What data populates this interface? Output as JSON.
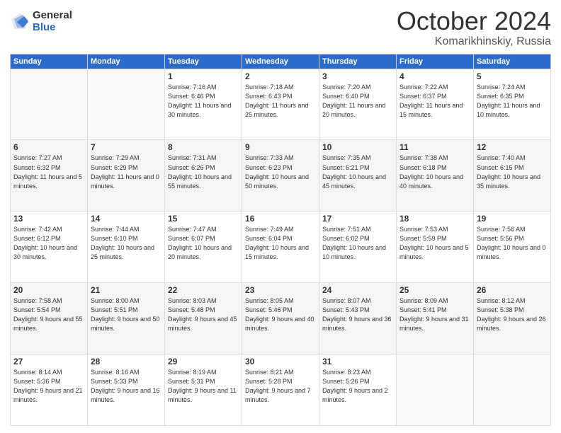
{
  "logo": {
    "general": "General",
    "blue": "Blue"
  },
  "title": {
    "month": "October 2024",
    "location": "Komarikhinskiy, Russia"
  },
  "weekdays": [
    "Sunday",
    "Monday",
    "Tuesday",
    "Wednesday",
    "Thursday",
    "Friday",
    "Saturday"
  ],
  "weeks": [
    [
      {
        "day": "",
        "info": ""
      },
      {
        "day": "",
        "info": ""
      },
      {
        "day": "1",
        "info": "Sunrise: 7:16 AM\nSunset: 6:46 PM\nDaylight: 11 hours\nand 30 minutes."
      },
      {
        "day": "2",
        "info": "Sunrise: 7:18 AM\nSunset: 6:43 PM\nDaylight: 11 hours\nand 25 minutes."
      },
      {
        "day": "3",
        "info": "Sunrise: 7:20 AM\nSunset: 6:40 PM\nDaylight: 11 hours\nand 20 minutes."
      },
      {
        "day": "4",
        "info": "Sunrise: 7:22 AM\nSunset: 6:37 PM\nDaylight: 11 hours\nand 15 minutes."
      },
      {
        "day": "5",
        "info": "Sunrise: 7:24 AM\nSunset: 6:35 PM\nDaylight: 11 hours\nand 10 minutes."
      }
    ],
    [
      {
        "day": "6",
        "info": "Sunrise: 7:27 AM\nSunset: 6:32 PM\nDaylight: 11 hours\nand 5 minutes."
      },
      {
        "day": "7",
        "info": "Sunrise: 7:29 AM\nSunset: 6:29 PM\nDaylight: 11 hours\nand 0 minutes."
      },
      {
        "day": "8",
        "info": "Sunrise: 7:31 AM\nSunset: 6:26 PM\nDaylight: 10 hours\nand 55 minutes."
      },
      {
        "day": "9",
        "info": "Sunrise: 7:33 AM\nSunset: 6:23 PM\nDaylight: 10 hours\nand 50 minutes."
      },
      {
        "day": "10",
        "info": "Sunrise: 7:35 AM\nSunset: 6:21 PM\nDaylight: 10 hours\nand 45 minutes."
      },
      {
        "day": "11",
        "info": "Sunrise: 7:38 AM\nSunset: 6:18 PM\nDaylight: 10 hours\nand 40 minutes."
      },
      {
        "day": "12",
        "info": "Sunrise: 7:40 AM\nSunset: 6:15 PM\nDaylight: 10 hours\nand 35 minutes."
      }
    ],
    [
      {
        "day": "13",
        "info": "Sunrise: 7:42 AM\nSunset: 6:12 PM\nDaylight: 10 hours\nand 30 minutes."
      },
      {
        "day": "14",
        "info": "Sunrise: 7:44 AM\nSunset: 6:10 PM\nDaylight: 10 hours\nand 25 minutes."
      },
      {
        "day": "15",
        "info": "Sunrise: 7:47 AM\nSunset: 6:07 PM\nDaylight: 10 hours\nand 20 minutes."
      },
      {
        "day": "16",
        "info": "Sunrise: 7:49 AM\nSunset: 6:04 PM\nDaylight: 10 hours\nand 15 minutes."
      },
      {
        "day": "17",
        "info": "Sunrise: 7:51 AM\nSunset: 6:02 PM\nDaylight: 10 hours\nand 10 minutes."
      },
      {
        "day": "18",
        "info": "Sunrise: 7:53 AM\nSunset: 5:59 PM\nDaylight: 10 hours\nand 5 minutes."
      },
      {
        "day": "19",
        "info": "Sunrise: 7:56 AM\nSunset: 5:56 PM\nDaylight: 10 hours\nand 0 minutes."
      }
    ],
    [
      {
        "day": "20",
        "info": "Sunrise: 7:58 AM\nSunset: 5:54 PM\nDaylight: 9 hours\nand 55 minutes."
      },
      {
        "day": "21",
        "info": "Sunrise: 8:00 AM\nSunset: 5:51 PM\nDaylight: 9 hours\nand 50 minutes."
      },
      {
        "day": "22",
        "info": "Sunrise: 8:03 AM\nSunset: 5:48 PM\nDaylight: 9 hours\nand 45 minutes."
      },
      {
        "day": "23",
        "info": "Sunrise: 8:05 AM\nSunset: 5:46 PM\nDaylight: 9 hours\nand 40 minutes."
      },
      {
        "day": "24",
        "info": "Sunrise: 8:07 AM\nSunset: 5:43 PM\nDaylight: 9 hours\nand 36 minutes."
      },
      {
        "day": "25",
        "info": "Sunrise: 8:09 AM\nSunset: 5:41 PM\nDaylight: 9 hours\nand 31 minutes."
      },
      {
        "day": "26",
        "info": "Sunrise: 8:12 AM\nSunset: 5:38 PM\nDaylight: 9 hours\nand 26 minutes."
      }
    ],
    [
      {
        "day": "27",
        "info": "Sunrise: 8:14 AM\nSunset: 5:36 PM\nDaylight: 9 hours\nand 21 minutes."
      },
      {
        "day": "28",
        "info": "Sunrise: 8:16 AM\nSunset: 5:33 PM\nDaylight: 9 hours\nand 16 minutes."
      },
      {
        "day": "29",
        "info": "Sunrise: 8:19 AM\nSunset: 5:31 PM\nDaylight: 9 hours\nand 11 minutes."
      },
      {
        "day": "30",
        "info": "Sunrise: 8:21 AM\nSunset: 5:28 PM\nDaylight: 9 hours\nand 7 minutes."
      },
      {
        "day": "31",
        "info": "Sunrise: 8:23 AM\nSunset: 5:26 PM\nDaylight: 9 hours\nand 2 minutes."
      },
      {
        "day": "",
        "info": ""
      },
      {
        "day": "",
        "info": ""
      }
    ]
  ]
}
